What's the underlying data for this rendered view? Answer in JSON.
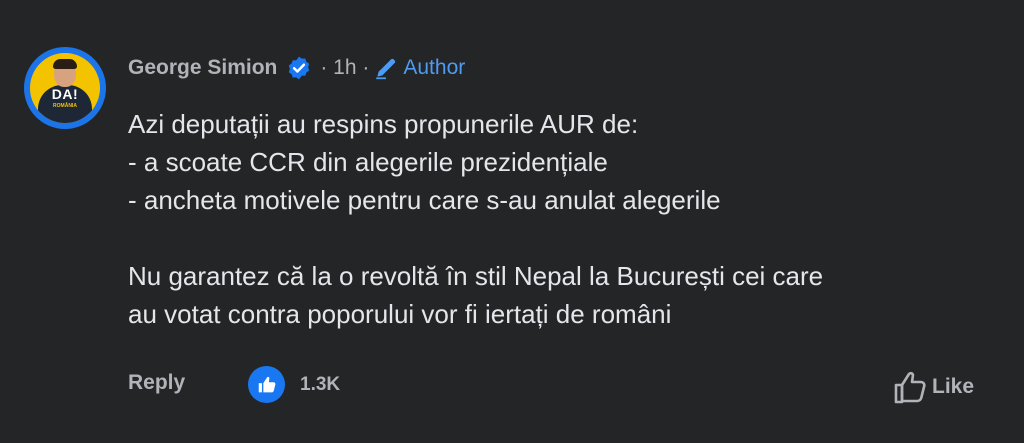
{
  "comment": {
    "author_name": "George Simion",
    "avatar": {
      "badge_text": "DA!",
      "badge_sub": "ROMÂNIA"
    },
    "verified_icon": "verified-badge-icon",
    "meta": "· 1h ·",
    "author_badge_icon": "pencil-icon",
    "author_label": "Author",
    "lines": [
      "Azi deputații au respins propunerile AUR de:",
      "- a scoate CCR din alegerile prezidențiale",
      "- ancheta motivele pentru care s-au anulat alegerile",
      "Nu garantez că la o revoltă în stil Nepal la București cei care",
      "au votat contra poporului vor fi iertați de români"
    ],
    "reply_label": "Reply",
    "reaction_icon": "thumbs-up-icon",
    "reaction_count": "1.3K",
    "like_label": "Like"
  },
  "colors": {
    "background": "#242526",
    "text": "#e4e6eb",
    "muted": "#b0b3b8",
    "accent": "#4e9bf2",
    "like_blue": "#1a77f2",
    "avatar_ring": "#1c74e9",
    "avatar_bg": "#f4c300"
  }
}
